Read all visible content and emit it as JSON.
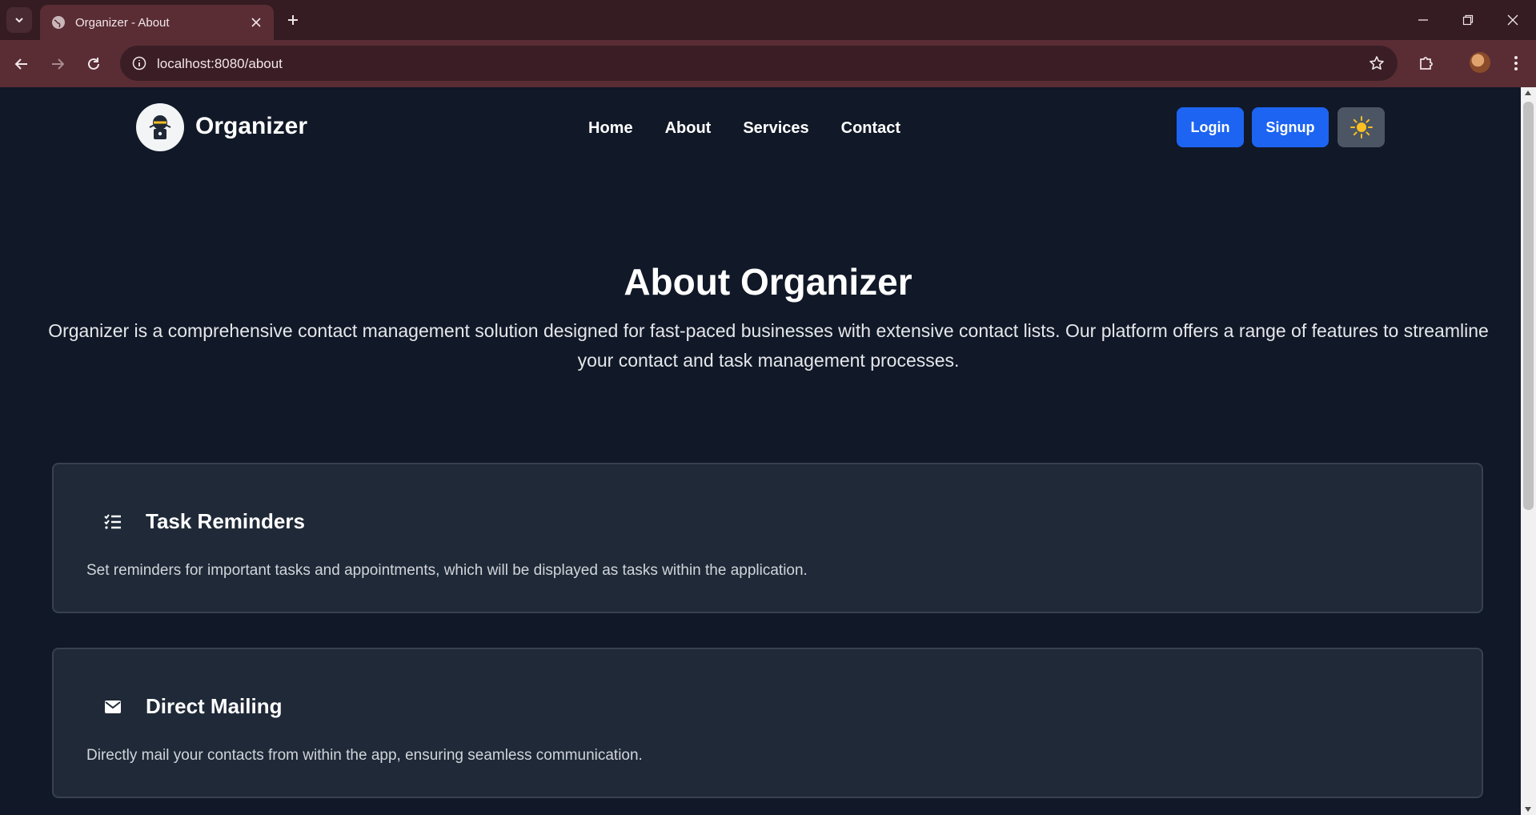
{
  "browser": {
    "tab_title": "Organizer - About",
    "url": "localhost:8080/about"
  },
  "navbar": {
    "brand": "Organizer",
    "links": [
      "Home",
      "About",
      "Services",
      "Contact"
    ],
    "login_label": "Login",
    "signup_label": "Signup"
  },
  "hero": {
    "title": "About Organizer",
    "description": "Organizer is a comprehensive contact management solution designed for fast-paced businesses with extensive contact lists. Our platform offers a range of features to streamline your contact and task management processes."
  },
  "features": [
    {
      "icon": "list-check-icon",
      "title": "Task Reminders",
      "description": "Set reminders for important tasks and appointments, which will be displayed as tasks within the application."
    },
    {
      "icon": "envelope-icon",
      "title": "Direct Mailing",
      "description": "Directly mail your contacts from within the app, ensuring seamless communication."
    }
  ],
  "colors": {
    "page_bg": "#111827",
    "card_bg": "#1f2937",
    "primary_button": "#1d64f2",
    "browser_frame": "#5a2d35"
  }
}
